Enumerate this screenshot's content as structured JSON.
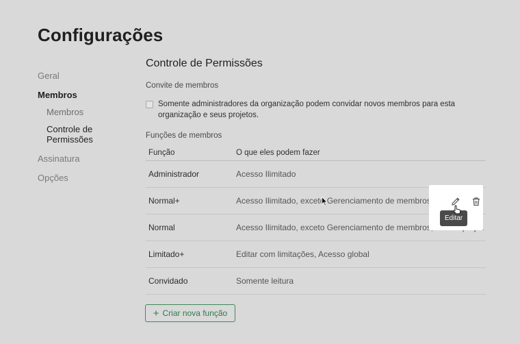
{
  "page": {
    "title": "Configurações"
  },
  "sidebar": {
    "items": [
      {
        "label": "Geral"
      },
      {
        "label": "Membros"
      },
      {
        "label": "Membros"
      },
      {
        "label": "Controle de Permissões"
      },
      {
        "label": "Assinatura"
      },
      {
        "label": "Opções"
      }
    ]
  },
  "main": {
    "section_title": "Controle de Permissões",
    "invite_heading": "Convite de membros",
    "invite_checkbox_label": "Somente administradores da organização podem convidar novos membros para esta organização e seus projetos.",
    "invite_checkbox_checked": false,
    "roles_heading": "Funções de membros",
    "table": {
      "headers": [
        "Função",
        "O que eles podem fazer"
      ],
      "rows": [
        {
          "name": "Administrador",
          "permissions": "Acesso Ilimitado"
        },
        {
          "name": "Normal+",
          "permissions": "Acesso Ilimitado, exceto Gerenciamento de membros"
        },
        {
          "name": "Normal",
          "permissions": "Acesso Ilimitado, exceto Gerenciamento de membros, Excluir projetos"
        },
        {
          "name": "Limitado+",
          "permissions": "Editar com limitações, Acesso global"
        },
        {
          "name": "Convidado",
          "permissions": "Somente leitura"
        }
      ]
    },
    "row_actions": {
      "tooltip": "Editar",
      "edit_icon": "pencil-icon",
      "delete_icon": "trash-icon"
    },
    "create_button": {
      "label": "Criar nova função",
      "icon": "plus-icon"
    }
  },
  "colors": {
    "background": "#d9d9d9",
    "accent": "#2f7a4c",
    "tooltip": "#4a4a4a"
  }
}
